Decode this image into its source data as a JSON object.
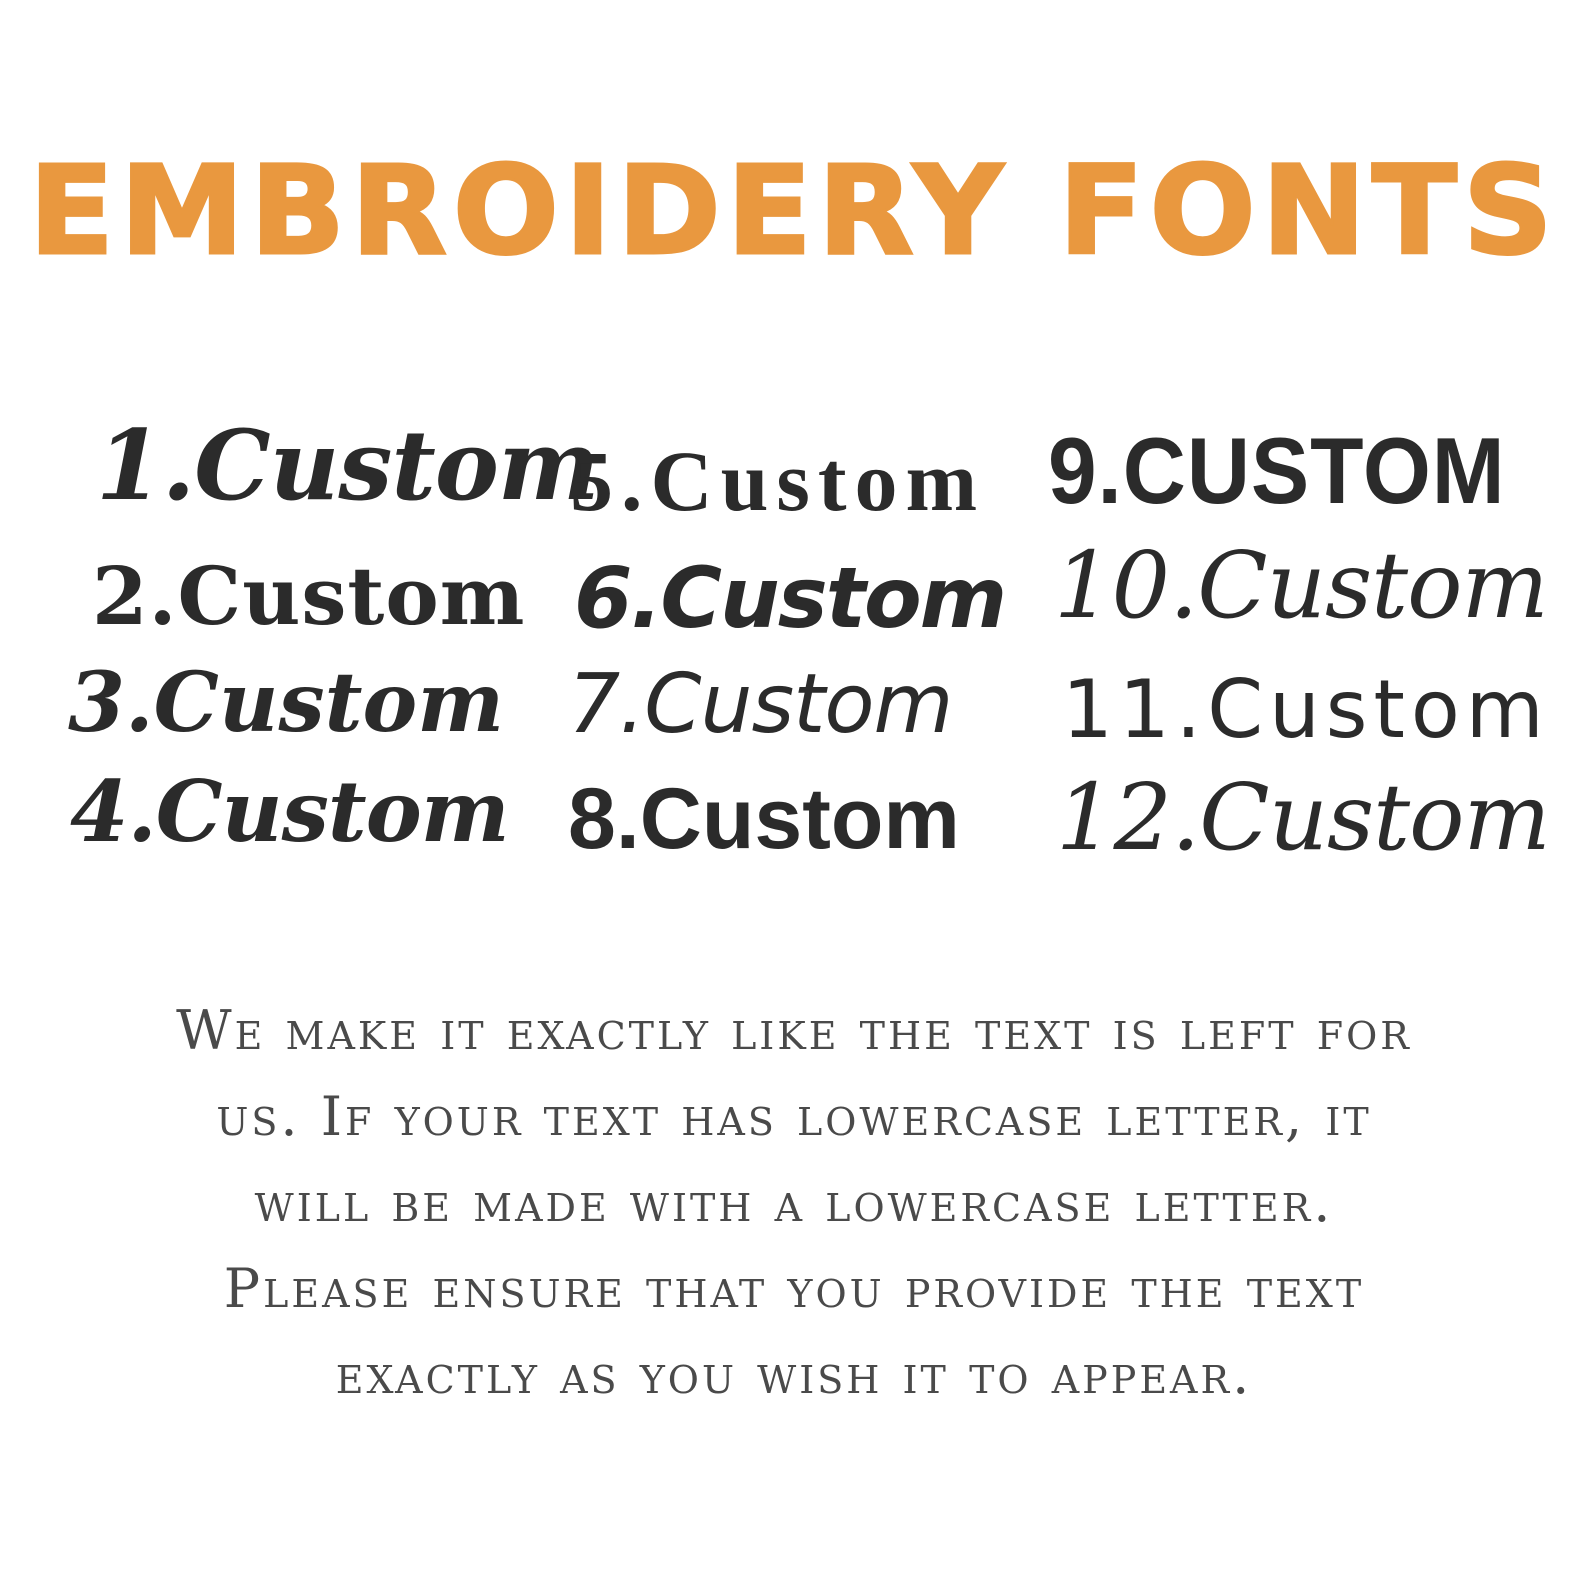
{
  "colors": {
    "title": "#E9983F",
    "sample_text": "#2B2B2B",
    "notice_text": "#4A4A4A",
    "background": "#FFFFFF"
  },
  "title": "EMBROIDERY FONTS",
  "font_samples": {
    "column_1": [
      "1.Custom",
      "2.Custom",
      "3.Custom",
      "4.Custom"
    ],
    "column_2": [
      "5.Custom",
      "6.Custom",
      "7.Custom",
      "8.Custom"
    ],
    "column_3": [
      "9.CUSTOM",
      "10.Custom",
      "11.Custom",
      "12.Custom"
    ]
  },
  "notice": {
    "lines": [
      "We make it exactly like the text is left for",
      "us. If your text has lowercase letter, it",
      "will be made with a lowercase letter.",
      "Please ensure that you provide the text",
      "exactly as you wish it to appear."
    ]
  }
}
